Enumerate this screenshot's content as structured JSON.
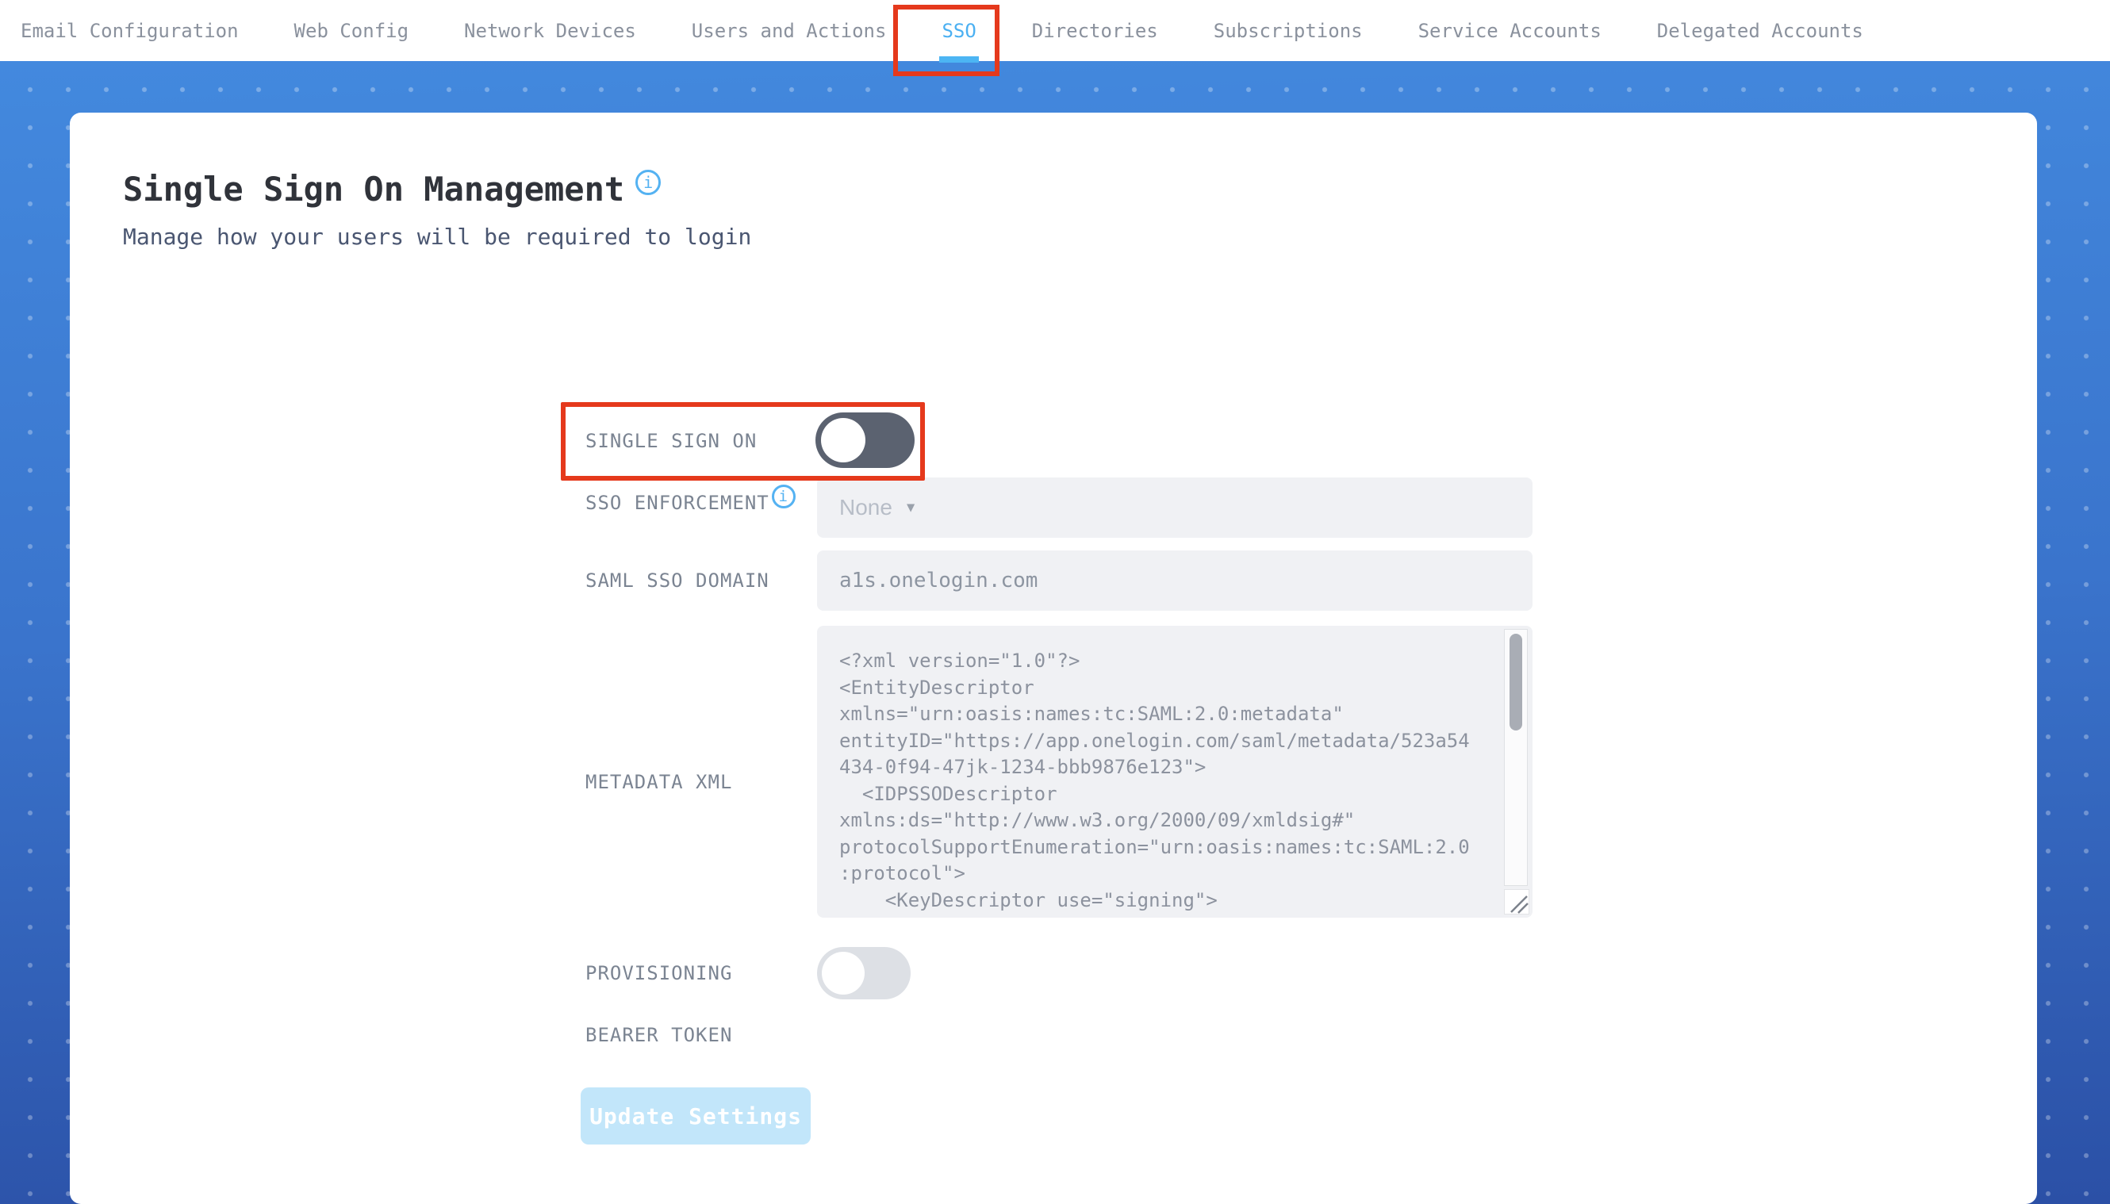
{
  "nav": {
    "tabs": [
      {
        "label": "Email Configuration",
        "active": false
      },
      {
        "label": "Web Config",
        "active": false
      },
      {
        "label": "Network Devices",
        "active": false
      },
      {
        "label": "Users and Actions",
        "active": false
      },
      {
        "label": "SSO",
        "active": true
      },
      {
        "label": "Directories",
        "active": false
      },
      {
        "label": "Subscriptions",
        "active": false
      },
      {
        "label": "Service Accounts",
        "active": false
      },
      {
        "label": "Delegated Accounts",
        "active": false
      }
    ]
  },
  "header": {
    "title": "Single Sign On Management",
    "subtitle": "Manage how your users will be required to login"
  },
  "form": {
    "single_sign_on": {
      "label": "SINGLE SIGN ON",
      "state": "off"
    },
    "sso_enforcement": {
      "label": "SSO ENFORCEMENT",
      "value": "None"
    },
    "saml_sso_domain": {
      "label": "SAML SSO DOMAIN",
      "value": "a1s.onelogin.com"
    },
    "metadata_xml": {
      "label": "METADATA XML",
      "value": "<?xml version=\"1.0\"?>\n<EntityDescriptor\nxmlns=\"urn:oasis:names:tc:SAML:2.0:metadata\"\nentityID=\"https://app.onelogin.com/saml/metadata/523a54\n434-0f94-47jk-1234-bbb9876e123\">\n  <IDPSSODescriptor\nxmlns:ds=\"http://www.w3.org/2000/09/xmldsig#\"\nprotocolSupportEnumeration=\"urn:oasis:names:tc:SAML:2.0\n:protocol\">\n    <KeyDescriptor use=\"signing\">\n      <ds:KeyInfo"
    },
    "provisioning": {
      "label": "PROVISIONING",
      "state": "off"
    },
    "bearer_token": {
      "label": "BEARER TOKEN"
    },
    "update_button_label": "Update Settings"
  },
  "icons": {
    "info": "i",
    "dropdown_caret": "▼"
  },
  "colors": {
    "accent_blue": "#4bb0f2",
    "annotation_red": "#e5391c",
    "background_gradient_top": "#4389de",
    "background_gradient_bottom": "#2b50a6",
    "toggle_on_track": "#5b6270",
    "toggle_off_track": "#dde0e5",
    "button_disabled_bg": "#c2e6fa"
  }
}
